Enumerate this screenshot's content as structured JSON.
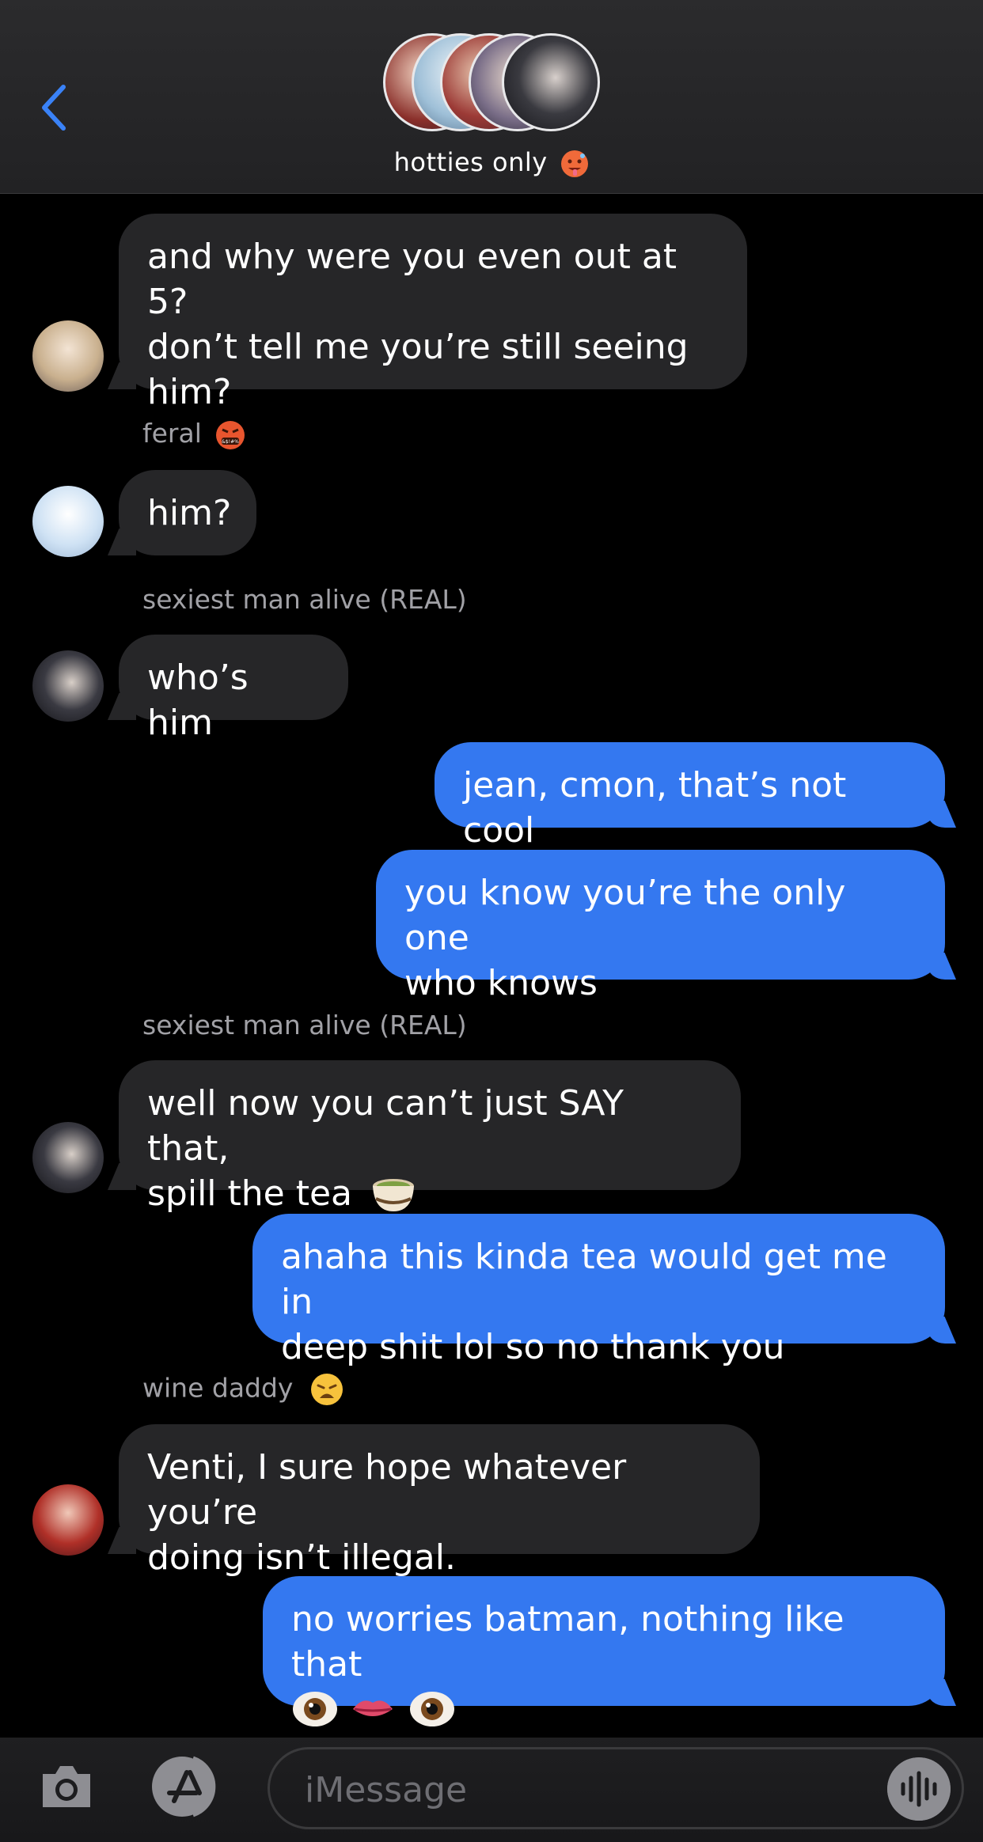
{
  "header": {
    "group_name": "hotties only",
    "group_emoji": "hot-face-emoji"
  },
  "messages": [
    {
      "dir": "in",
      "sender": "",
      "text_lines": [
        "and why were you even out at 5?",
        "don’t tell me you’re still seeing",
        "him?"
      ]
    },
    {
      "dir": "in",
      "sender": "feral",
      "text_lines": [
        "him?"
      ]
    },
    {
      "dir": "in",
      "sender": "sexiest man alive (REAL)",
      "text_lines": [
        "who’s him"
      ]
    },
    {
      "dir": "out",
      "text_lines": [
        "jean, cmon, that’s not cool"
      ]
    },
    {
      "dir": "out",
      "text_lines": [
        "you know you’re the only one",
        "who knows"
      ]
    },
    {
      "dir": "in",
      "sender": "sexiest man alive (REAL)",
      "text_lines": [
        "well now you can’t just SAY that,",
        "spill the tea"
      ]
    },
    {
      "dir": "out",
      "text_lines": [
        "ahaha this kinda tea would get me in",
        "deep shit lol so no thank you"
      ]
    },
    {
      "dir": "in",
      "sender": "wine daddy",
      "text_lines": [
        "Venti, I sure hope whatever you’re",
        "doing isn’t illegal."
      ]
    },
    {
      "dir": "out",
      "text_lines": [
        "no worries batman, nothing like that"
      ]
    }
  ],
  "input": {
    "placeholder": "iMessage"
  },
  "colors": {
    "outgoing_bubble": "#3478f0",
    "incoming_bubble": "#262628",
    "accent": "#3a82f7"
  }
}
